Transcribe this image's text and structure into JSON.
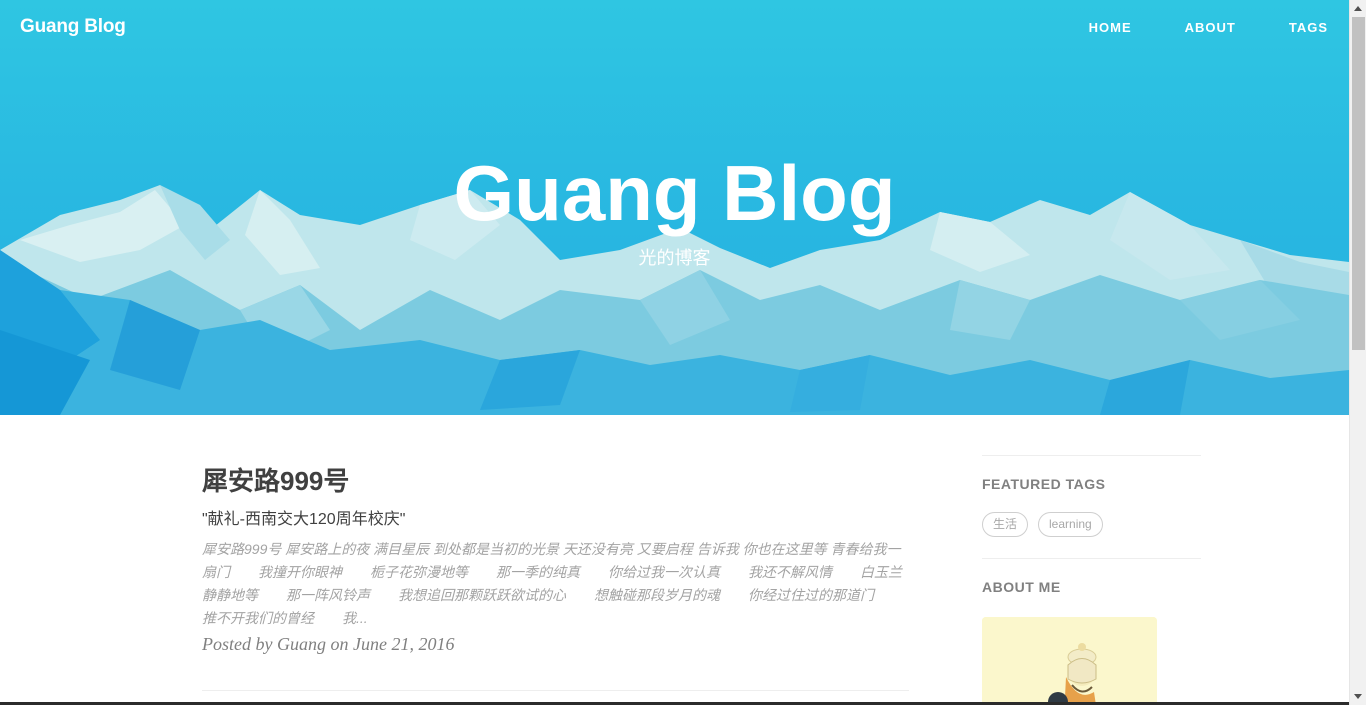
{
  "brand": "Guang Blog",
  "nav": [
    "HOME",
    "ABOUT",
    "TAGS"
  ],
  "hero": {
    "title": "Guang Blog",
    "subtitle": "光的博客"
  },
  "post": {
    "title": "犀安路999号",
    "subtitle": "\"献礼-西南交大120周年校庆\"",
    "excerpt": "犀安路999号 犀安路上的夜 满目星辰 到处都是当初的光景 天还没有亮 又要启程 告诉我 你也在这里等 青春给我一扇门　　我撞开你眼神　　栀子花弥漫地等　　那一季的纯真　　你给过我一次认真　　我还不解风情　　白玉兰静静地等　　那一阵风铃声　　我想追回那颗跃跃欲试的心　　想触碰那段岁月的魂　　你经过住过的那道门　　推不开我们的曾经　　我...",
    "meta": "Posted by Guang on June 21, 2016"
  },
  "sidebar": {
    "featured_tags_heading": "FEATURED TAGS",
    "tags": [
      "生活",
      "learning"
    ],
    "about_heading": "ABOUT ME"
  },
  "colors": {
    "hero_top": "#2fc6e2",
    "hero_bottom": "#25aee0",
    "text_dark": "#404040",
    "text_muted": "#a3a3a3"
  }
}
